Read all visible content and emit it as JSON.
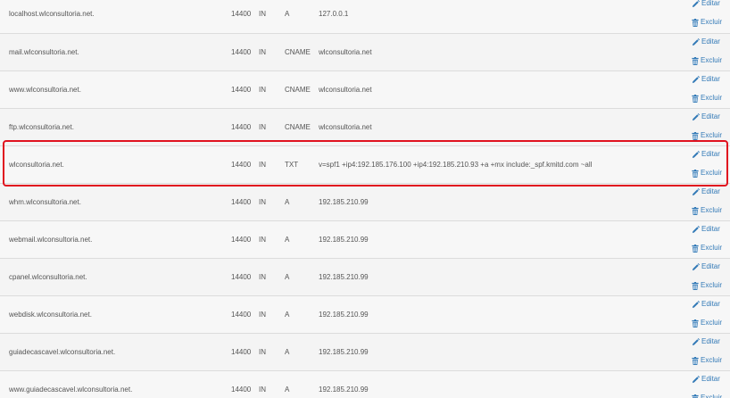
{
  "actions": {
    "edit_label": "Editar",
    "delete_label": "Excluir"
  },
  "colors": {
    "link": "#337ab7",
    "highlight_border": "#e0121f"
  },
  "records": [
    {
      "name": "localhost.wlconsultoria.net.",
      "ttl": "14400",
      "class": "IN",
      "type": "A",
      "record": "127.0.0.1"
    },
    {
      "name": "mail.wlconsultoria.net.",
      "ttl": "14400",
      "class": "IN",
      "type": "CNAME",
      "record": "wlconsultoria.net"
    },
    {
      "name": "www.wlconsultoria.net.",
      "ttl": "14400",
      "class": "IN",
      "type": "CNAME",
      "record": "wlconsultoria.net"
    },
    {
      "name": "ftp.wlconsultoria.net.",
      "ttl": "14400",
      "class": "IN",
      "type": "CNAME",
      "record": "wlconsultoria.net"
    },
    {
      "name": "wlconsultoria.net.",
      "ttl": "14400",
      "class": "IN",
      "type": "TXT",
      "record": "v=spf1 +ip4:192.185.176.100 +ip4:192.185.210.93 +a +mx include:_spf.kmitd.com ~all",
      "highlighted": true
    },
    {
      "name": "whm.wlconsultoria.net.",
      "ttl": "14400",
      "class": "IN",
      "type": "A",
      "record": "192.185.210.99"
    },
    {
      "name": "webmail.wlconsultoria.net.",
      "ttl": "14400",
      "class": "IN",
      "type": "A",
      "record": "192.185.210.99"
    },
    {
      "name": "cpanel.wlconsultoria.net.",
      "ttl": "14400",
      "class": "IN",
      "type": "A",
      "record": "192.185.210.99"
    },
    {
      "name": "webdisk.wlconsultoria.net.",
      "ttl": "14400",
      "class": "IN",
      "type": "A",
      "record": "192.185.210.99"
    },
    {
      "name": "guiadecascavel.wlconsultoria.net.",
      "ttl": "14400",
      "class": "IN",
      "type": "A",
      "record": "192.185.210.99"
    },
    {
      "name": "www.guiadecascavel.wlconsultoria.net.",
      "ttl": "14400",
      "class": "IN",
      "type": "A",
      "record": "192.185.210.99"
    }
  ]
}
